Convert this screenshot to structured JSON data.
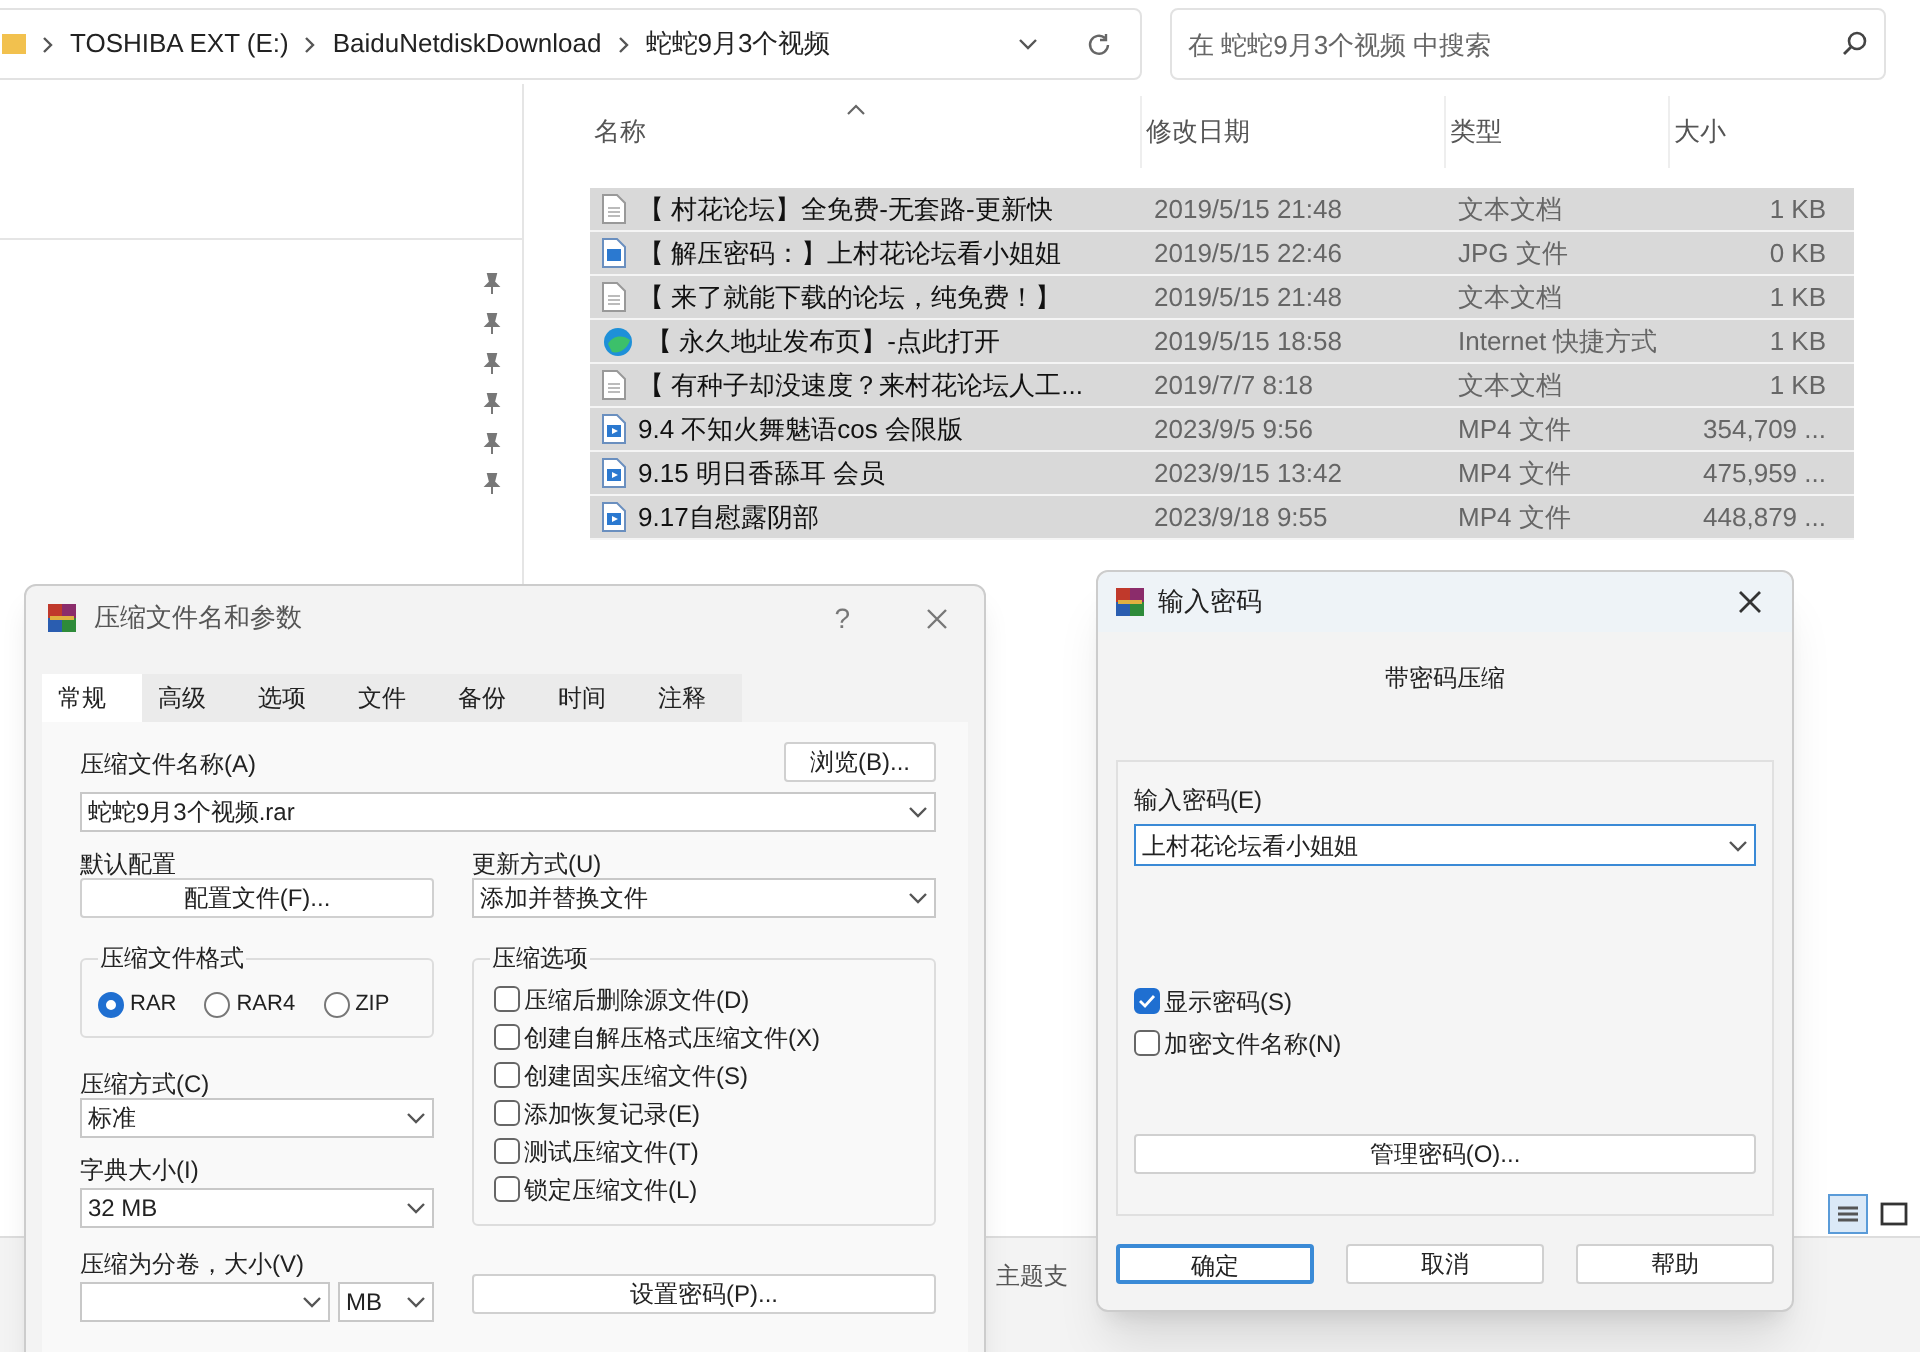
{
  "address_bar": {
    "crumbs": [
      "TOSHIBA EXT (E:)",
      "BaiduNetdiskDownload",
      "蛇蛇9月3个视频"
    ]
  },
  "search": {
    "placeholder": "在 蛇蛇9月3个视频 中搜索"
  },
  "file_list": {
    "columns": [
      "名称",
      "修改日期",
      "类型",
      "大小"
    ],
    "rows": [
      {
        "kind": "text",
        "name": "【 村花论坛】全免费-无套路-更新快",
        "date": "2019/5/15 21:48",
        "type": "文本文档",
        "size": "1 KB",
        "selected": true
      },
      {
        "kind": "image",
        "name": "【 解压密码：】上村花论坛看小姐姐",
        "date": "2019/5/15 22:46",
        "type": "JPG 文件",
        "size": "0 KB",
        "selected": true
      },
      {
        "kind": "text",
        "name": "【 来了就能下载的论坛，纯免费！】",
        "date": "2019/5/15 21:48",
        "type": "文本文档",
        "size": "1 KB",
        "selected": true
      },
      {
        "kind": "link",
        "name": "【 永久地址发布页】-点此打开",
        "date": "2019/5/15 18:58",
        "type": "Internet 快捷方式",
        "size": "1 KB",
        "selected": true
      },
      {
        "kind": "text",
        "name": "【 有种子却没速度？来村花论坛人工...",
        "date": "2019/7/7 8:18",
        "type": "文本文档",
        "size": "1 KB",
        "selected": true
      },
      {
        "kind": "video",
        "name": "9.4 不知火舞魅语cos 会限版",
        "date": "2023/9/5 9:56",
        "type": "MP4 文件",
        "size": "354,709 ...",
        "selected": true
      },
      {
        "kind": "video",
        "name": "9.15 明日香舔耳 会员",
        "date": "2023/9/15 13:42",
        "type": "MP4 文件",
        "size": "475,959 ...",
        "selected": true
      },
      {
        "kind": "video",
        "name": "9.17自慰露阴部",
        "date": "2023/9/18 9:55",
        "type": "MP4 文件",
        "size": "448,879 ...",
        "selected": true
      }
    ]
  },
  "status_fragment": "主题支",
  "archive_dialog": {
    "title": "压缩文件名和参数",
    "help_button": "?",
    "tabs": [
      {
        "label": "常规",
        "selected": true
      },
      {
        "label": "高级",
        "selected": false
      },
      {
        "label": "选项",
        "selected": false
      },
      {
        "label": "文件",
        "selected": false
      },
      {
        "label": "备份",
        "selected": false
      },
      {
        "label": "时间",
        "selected": false
      },
      {
        "label": "注释",
        "selected": false
      }
    ],
    "name_label": "压缩文件名称(A)",
    "browse_button": "浏览(B)...",
    "name_value": "蛇蛇9月3个视频.rar",
    "profile_label": "默认配置",
    "profile_button": "配置文件(F)...",
    "update_label": "更新方式(U)",
    "update_value": "添加并替换文件",
    "format_group": {
      "title": "压缩文件格式",
      "options": [
        {
          "label": "RAR",
          "selected": true
        },
        {
          "label": "RAR4",
          "selected": false
        },
        {
          "label": "ZIP",
          "selected": false
        }
      ]
    },
    "options_group": {
      "title": "压缩选项",
      "items": [
        {
          "label": "压缩后删除源文件(D)",
          "checked": false
        },
        {
          "label": "创建自解压格式压缩文件(X)",
          "checked": false
        },
        {
          "label": "创建固实压缩文件(S)",
          "checked": false
        },
        {
          "label": "添加恢复记录(E)",
          "checked": false
        },
        {
          "label": "测试压缩文件(T)",
          "checked": false
        },
        {
          "label": "锁定压缩文件(L)",
          "checked": false
        }
      ]
    },
    "method_label": "压缩方式(C)",
    "method_value": "标准",
    "dict_label": "字典大小(I)",
    "dict_value": "32 MB",
    "split_label": "压缩为分卷，大小(V)",
    "split_unit": "MB",
    "password_button": "设置密码(P)..."
  },
  "password_dialog": {
    "title": "输入密码",
    "heading": "带密码压缩",
    "field_label": "输入密码(E)",
    "field_value": "上村花论坛看小姐姐",
    "checkboxes": [
      {
        "label": "显示密码(S)",
        "checked": true
      },
      {
        "label": "加密文件名称(N)",
        "checked": false
      }
    ],
    "manage_button": "管理密码(O)...",
    "buttons": [
      {
        "label": "确定",
        "focused": true
      },
      {
        "label": "取消",
        "focused": false
      },
      {
        "label": "帮助",
        "focused": false
      }
    ]
  }
}
